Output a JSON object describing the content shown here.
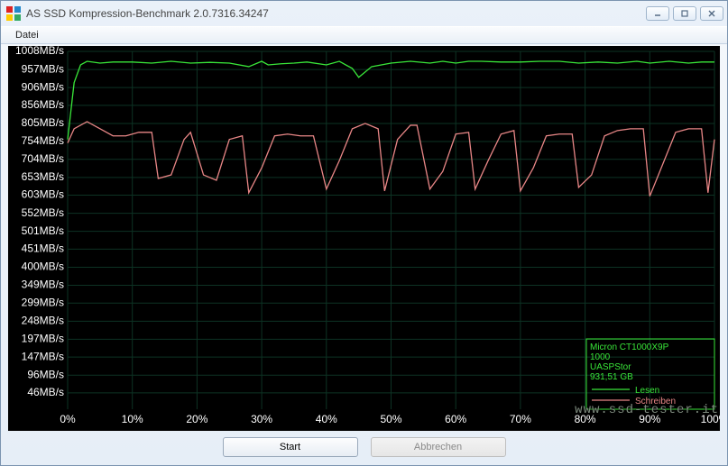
{
  "window": {
    "title": "AS SSD Kompression-Benchmark 2.0.7316.34247"
  },
  "menu": {
    "file": "Datei"
  },
  "buttons": {
    "start": "Start",
    "cancel": "Abbrechen"
  },
  "legend": {
    "device_line1": "Micron CT1000X9P",
    "device_line2": "1000",
    "controller": "UASPStor",
    "capacity": "931,51 GB",
    "read": "Lesen",
    "write": "Schreiben"
  },
  "watermark": "www.ssd-tester.it",
  "chart_data": {
    "type": "line",
    "xlabel": "",
    "ylabel": "",
    "x_unit": "%",
    "y_unit": "MB/s",
    "xlim": [
      0,
      100
    ],
    "ylim": [
      0,
      1008
    ],
    "y_ticks": [
      46,
      96,
      147,
      197,
      248,
      299,
      349,
      400,
      451,
      501,
      552,
      603,
      653,
      704,
      754,
      805,
      856,
      906,
      957,
      1008
    ],
    "y_tick_labels": [
      "46MB/s",
      "96MB/s",
      "147MB/s",
      "197MB/s",
      "248MB/s",
      "299MB/s",
      "349MB/s",
      "400MB/s",
      "451MB/s",
      "501MB/s",
      "552MB/s",
      "603MB/s",
      "653MB/s",
      "704MB/s",
      "754MB/s",
      "805MB/s",
      "856MB/s",
      "906MB/s",
      "957MB/s",
      "1008MB/s"
    ],
    "x_ticks": [
      0,
      10,
      20,
      30,
      40,
      50,
      60,
      70,
      80,
      90,
      100
    ],
    "x_tick_labels": [
      "0%",
      "10%",
      "20%",
      "30%",
      "40%",
      "50%",
      "60%",
      "70%",
      "80%",
      "90%",
      "100%"
    ],
    "series": [
      {
        "name": "Lesen",
        "color": "#39e639",
        "x": [
          0,
          1,
          2,
          3,
          5,
          7,
          10,
          13,
          16,
          19,
          22,
          25,
          28,
          30,
          31,
          33,
          35,
          37,
          40,
          42,
          44,
          45,
          47,
          50,
          53,
          56,
          58,
          60,
          62,
          64,
          67,
          70,
          73,
          76,
          79,
          82,
          85,
          88,
          90,
          93,
          96,
          98,
          100
        ],
        "y": [
          760,
          920,
          970,
          980,
          975,
          978,
          978,
          975,
          980,
          975,
          977,
          975,
          965,
          980,
          970,
          973,
          975,
          978,
          970,
          980,
          960,
          935,
          965,
          975,
          980,
          975,
          980,
          975,
          980,
          980,
          978,
          978,
          980,
          980,
          975,
          978,
          975,
          980,
          975,
          980,
          975,
          978,
          978
        ]
      },
      {
        "name": "Schreiben",
        "color": "#e88686",
        "x": [
          0,
          1,
          3,
          5,
          7,
          9,
          11,
          13,
          14,
          16,
          18,
          19,
          21,
          23,
          25,
          27,
          28,
          30,
          32,
          34,
          36,
          38,
          40,
          42,
          44,
          46,
          48,
          49,
          51,
          53,
          54,
          56,
          58,
          60,
          62,
          63,
          65,
          67,
          69,
          70,
          72,
          74,
          76,
          78,
          79,
          81,
          83,
          85,
          87,
          89,
          90,
          92,
          94,
          96,
          98,
          99,
          100
        ],
        "y": [
          750,
          790,
          810,
          790,
          770,
          770,
          780,
          780,
          650,
          660,
          760,
          780,
          660,
          645,
          760,
          770,
          610,
          680,
          770,
          775,
          770,
          770,
          620,
          700,
          790,
          805,
          790,
          615,
          760,
          800,
          800,
          620,
          670,
          775,
          780,
          620,
          700,
          775,
          785,
          615,
          680,
          770,
          775,
          775,
          625,
          660,
          770,
          785,
          790,
          790,
          600,
          690,
          780,
          790,
          790,
          610,
          760
        ]
      }
    ]
  }
}
